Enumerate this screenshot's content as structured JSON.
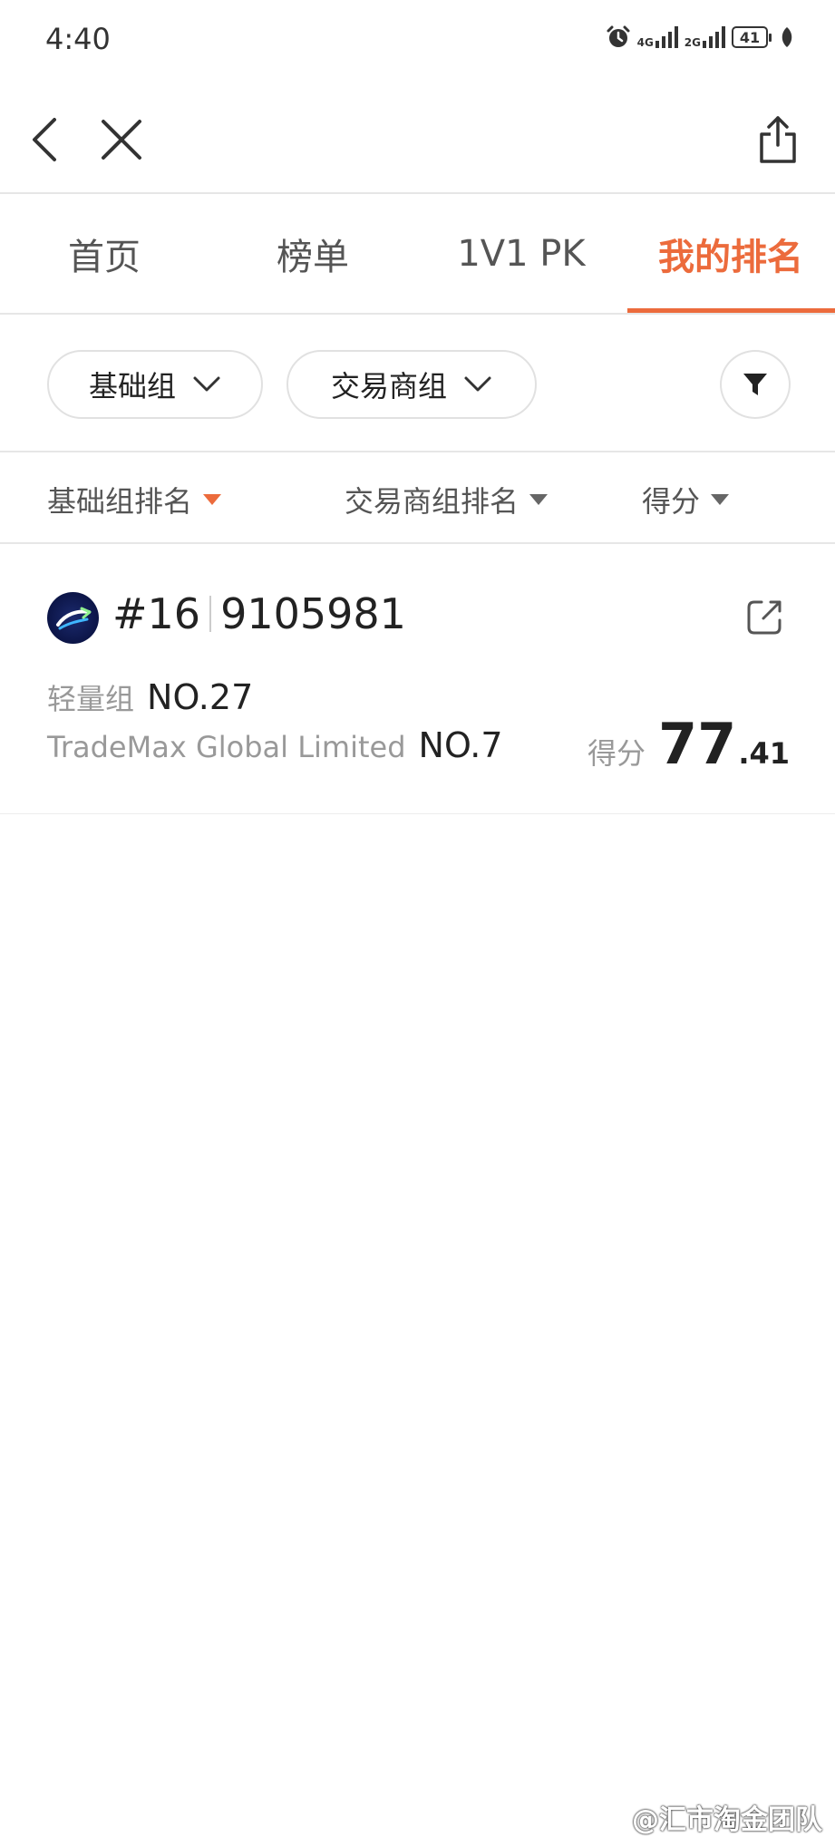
{
  "status_bar": {
    "time": "4:40",
    "network1": "4G",
    "network2": "2G",
    "battery": "41"
  },
  "tabs": [
    {
      "label": "首页"
    },
    {
      "label": "榜单"
    },
    {
      "label": "1V1 PK"
    },
    {
      "label": "我的排名"
    }
  ],
  "active_tab_index": 3,
  "filters": {
    "group": "基础组",
    "broker_group": "交易商组"
  },
  "sort_options": [
    {
      "label": "基础组排名",
      "active": true
    },
    {
      "label": "交易商组排名",
      "active": false
    },
    {
      "label": "得分",
      "active": false
    }
  ],
  "result": {
    "rank": "#16",
    "account": "9105981",
    "group_label": "轻量组",
    "group_rank": "NO.27",
    "broker_label": "TradeMax Global Limited",
    "broker_rank": "NO.7",
    "score_label": "得分",
    "score_int": "77",
    "score_dec": ".41"
  },
  "watermark": "@汇市淘金团队",
  "colors": {
    "accent": "#ec6b3c",
    "divider": "#e6e6e6",
    "muted_text": "#999999"
  },
  "icons": {
    "back": "chevron-left-icon",
    "close": "close-icon",
    "share": "share-icon",
    "filter": "filter-icon",
    "external": "external-link-icon",
    "alarm": "alarm-icon"
  }
}
